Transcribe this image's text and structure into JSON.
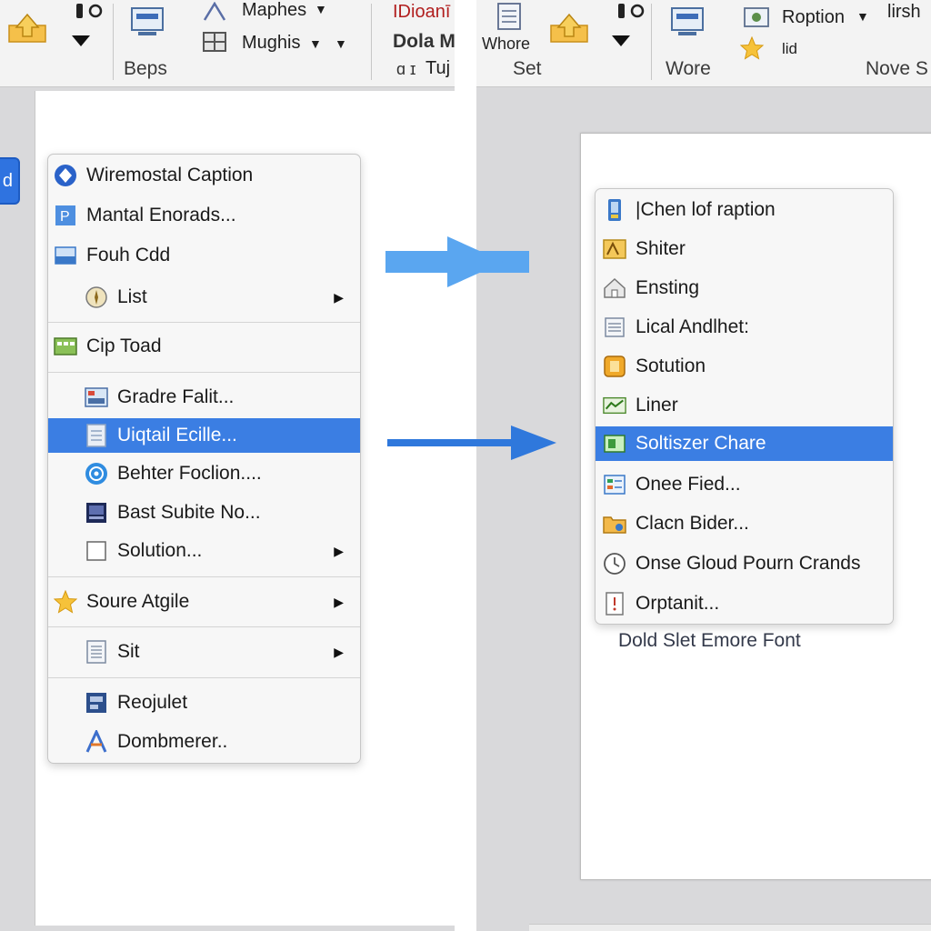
{
  "left": {
    "ribbon": {
      "item_maphes": "Maphes",
      "item_mughis": "Mughis",
      "item_idioan": "IDioanī",
      "item_dola": "Dola M",
      "item_tuj": "Tuj",
      "group_label": "Beps"
    },
    "side_button_label": "d",
    "context_menu": {
      "items": [
        {
          "label": "Wiremostal Caption"
        },
        {
          "label": "Mantal Enorads..."
        },
        {
          "label": "Fouh Cdd"
        },
        {
          "label": "List"
        },
        {
          "label": "Cip Toad"
        },
        {
          "label": "Gradre Falit..."
        },
        {
          "label": "Uiqtail Ecille..."
        },
        {
          "label": "Behter Foclion...."
        },
        {
          "label": "Bast Subite No..."
        },
        {
          "label": "Solution..."
        },
        {
          "label": "Soure Atgile"
        },
        {
          "label": "Sit"
        },
        {
          "label": "Reojulet"
        },
        {
          "label": "Dombmerer.."
        }
      ]
    }
  },
  "right": {
    "ribbon": {
      "item_whore": "Whore",
      "group_set": "Set",
      "group_wore": "Wore",
      "item_roption": "Roption",
      "item_lid": "lid",
      "item_lirsh": "lirsh",
      "group_nove": "Nove S"
    },
    "context_menu": {
      "items": [
        {
          "label": "|Chen lof raption"
        },
        {
          "label": "Shiter"
        },
        {
          "label": "Ensting"
        },
        {
          "label": "Lical Andlhet:"
        },
        {
          "label": "Sotution"
        },
        {
          "label": "Liner"
        },
        {
          "label": "Soltiszer Chare"
        },
        {
          "label": "Onee Fied..."
        },
        {
          "label": "Clacn Bider..."
        },
        {
          "label": "Onse Gloud Pourn Crands"
        },
        {
          "label": "Orptanit..."
        }
      ]
    },
    "caption_below": "Dold Slet Emore Font"
  },
  "colors": {
    "selection": "#3b7ee3",
    "arrow_light": "#5aa6f0",
    "arrow_dark": "#2f78dc"
  }
}
